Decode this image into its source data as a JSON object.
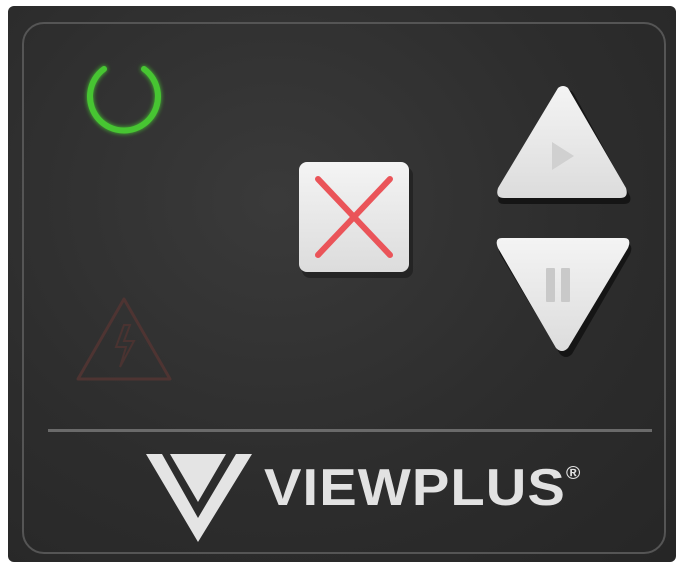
{
  "device": {
    "brand": "VIEWPLUS",
    "registered_mark": "®",
    "colors": {
      "panel": "#2f2f2f",
      "button": "#ebebeb",
      "power_led": "#4fcf3a",
      "stop_cross": "#e8555a",
      "warning_outline": "#5a3a38"
    }
  },
  "controls": {
    "power": {
      "icon": "power-icon",
      "led_on": true
    },
    "stop": {
      "icon": "close-icon"
    },
    "up": {
      "icon": "play-icon"
    },
    "down": {
      "icon": "pause-icon"
    },
    "warning": {
      "icon": "warning-icon"
    }
  }
}
